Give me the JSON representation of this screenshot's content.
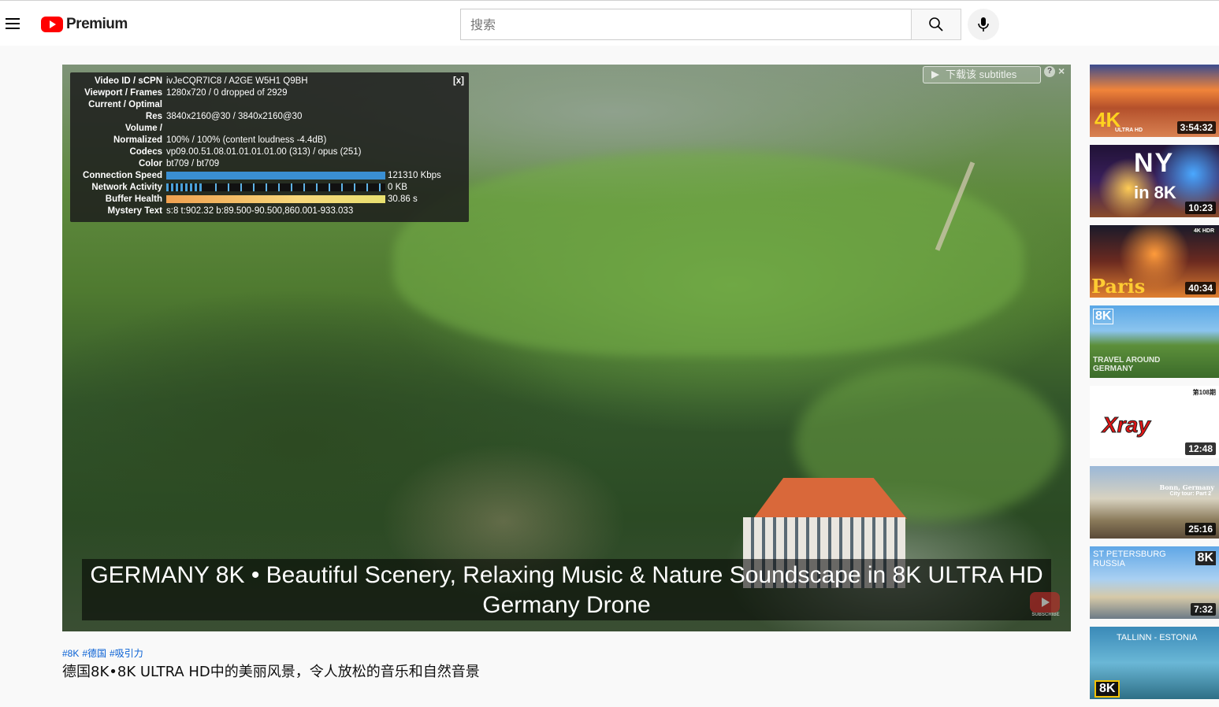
{
  "header": {
    "logo_text": "Premium",
    "search_placeholder": "搜索"
  },
  "stats": {
    "close_label": "[x]",
    "rows": [
      {
        "k": "Video ID / sCPN",
        "v": "ivJeCQR7IC8 / A2GE W5H1 Q9BH"
      },
      {
        "k": "Viewport / Frames",
        "v": "1280x720 / 0 dropped of 2929"
      },
      {
        "k": "Current / Optimal",
        "v": ""
      },
      {
        "k": "Res",
        "v": "3840x2160@30 / 3840x2160@30"
      },
      {
        "k": "Volume /",
        "v": ""
      },
      {
        "k": "Normalized",
        "v": "100% / 100% (content loudness -4.4dB)"
      },
      {
        "k": "Codecs",
        "v": "vp09.00.51.08.01.01.01.01.00 (313) / opus (251)"
      },
      {
        "k": "Color",
        "v": "bt709 / bt709"
      }
    ],
    "connection_speed_label": "Connection Speed",
    "connection_speed_value": "121310 Kbps",
    "network_activity_label": "Network Activity",
    "network_activity_value": "0 KB",
    "buffer_health_label": "Buffer Health",
    "buffer_health_value": "30.86 s",
    "mystery_text_label": "Mystery Text",
    "mystery_text_value": "s:8 t:902.32 b:89.500-90.500,860.001-933.033"
  },
  "subtitle_widget": {
    "button_label": "下载该 subtitles",
    "help_label": "?",
    "close_label": "×"
  },
  "player": {
    "overlay_title": "GERMANY 8K • Beautiful Scenery, Relaxing Music & Nature Soundscape in 8K ULTRA HD Germany Drone",
    "watermark_text": "SUBSCRIBE"
  },
  "video": {
    "hashtags": [
      "#8K",
      "#德国",
      "#吸引力"
    ],
    "title": "德国8K•8K ULTRA HD中的美丽风景，令人放松的音乐和自然音景"
  },
  "sidebar": {
    "items": [
      {
        "caption": "4K",
        "sub": "ULTRA HD",
        "duration": "3:54:32"
      },
      {
        "caption": "NY",
        "sub": "in 8K",
        "duration": "10:23"
      },
      {
        "caption": "Paris",
        "sub": "4K HDR",
        "duration": "40:34"
      },
      {
        "caption": "8K",
        "sub": "TRAVEL AROUND GERMANY",
        "duration": ""
      },
      {
        "caption": "Xray",
        "sub": "第108期",
        "duration": "12:48"
      },
      {
        "caption": "Bonn, Germany",
        "sub": "City tour: Part 2",
        "duration": "25:16"
      },
      {
        "caption": "ST PETERSBURG RUSSIA",
        "sub": "8K",
        "duration": "7:32"
      },
      {
        "caption": "TALLINN - ESTONIA",
        "sub": "8K",
        "duration": ""
      }
    ]
  }
}
